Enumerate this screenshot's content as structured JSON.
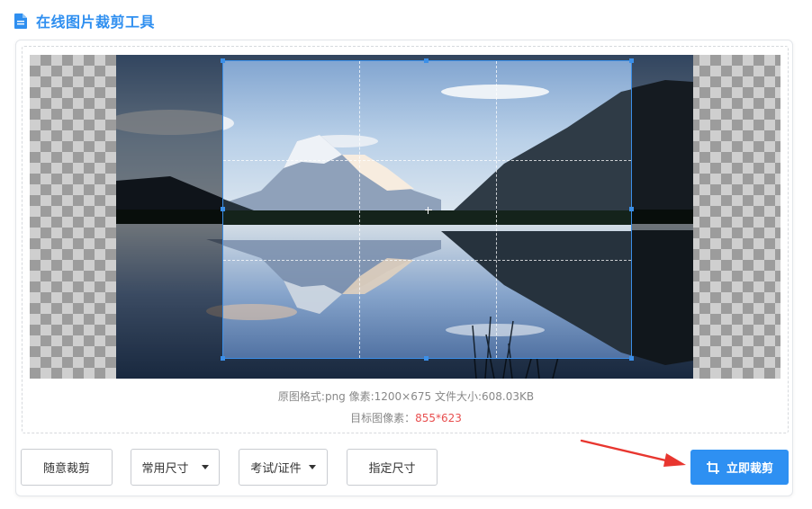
{
  "header": {
    "title": "在线图片裁剪工具",
    "icon": "document-icon",
    "accent": "#2f8ff0"
  },
  "info": {
    "original": "原图格式:png 像素:1200×675 文件大小:608.03KB",
    "target_label": "目标图像素：",
    "target_value": "855*623",
    "target_color": "#e84f4f"
  },
  "toolbar": {
    "free_crop": "随意裁剪",
    "common_size": "常用尺寸",
    "exam_id": "考试/证件",
    "custom_size": "指定尺寸",
    "crop_now": "立即裁剪",
    "primary_color": "#2e90f2"
  },
  "annotation": {
    "arrow_color": "#e8362f"
  }
}
